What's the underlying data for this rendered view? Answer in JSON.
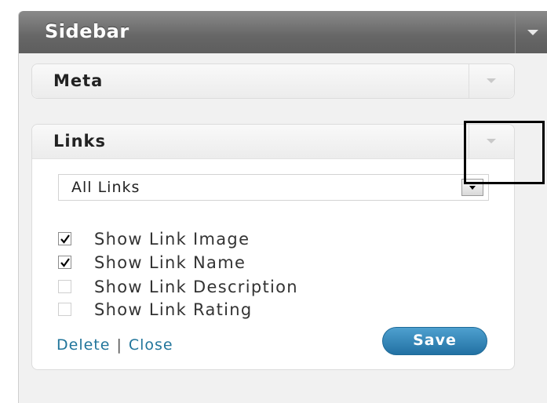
{
  "sidebar": {
    "title": "Sidebar",
    "toggle_icon": "triangle-down-icon"
  },
  "widgets": {
    "meta": {
      "title": "Meta",
      "toggle_icon": "triangle-down-icon"
    },
    "links": {
      "title": "Links",
      "toggle_icon": "triangle-down-icon",
      "category_select": {
        "value": "All Links",
        "icon": "dropdown-arrow-icon"
      },
      "options": [
        {
          "label": "Show Link Image",
          "checked": true
        },
        {
          "label": "Show Link Name",
          "checked": true
        },
        {
          "label": "Show Link Description",
          "checked": false
        },
        {
          "label": "Show Link Rating",
          "checked": false
        }
      ],
      "actions": {
        "delete_label": "Delete",
        "separator": "|",
        "close_label": "Close"
      },
      "save_label": "Save"
    }
  },
  "colors": {
    "header_gray": "#666666",
    "link_blue": "#21759b",
    "save_blue": "#2271a3"
  }
}
